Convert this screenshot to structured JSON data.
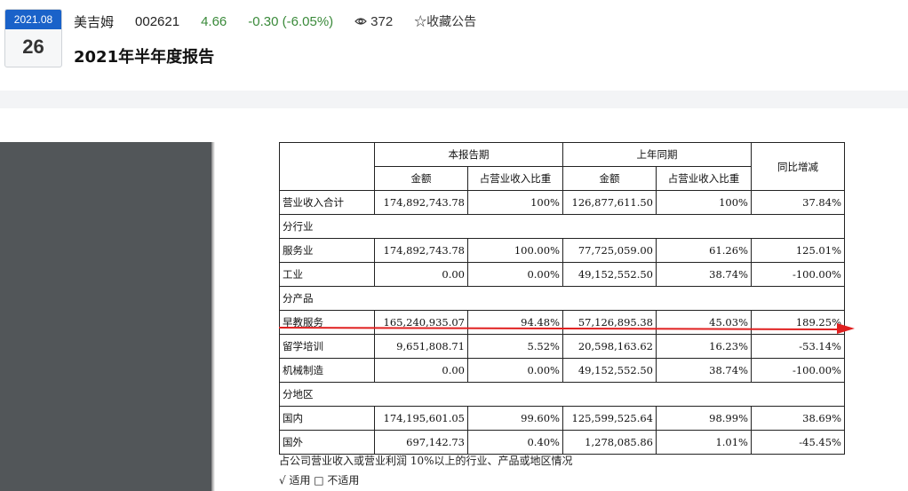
{
  "header": {
    "date_ym": "2021.08",
    "date_day": "26",
    "stock_name": "美吉姆",
    "stock_code": "002621",
    "price": "4.66",
    "change": "-0.30 (-6.05%)",
    "views": "372",
    "favorite_label": "☆收藏公告",
    "title": "2021年半年度报告"
  },
  "table": {
    "col_period_current": "本报告期",
    "col_period_prior": "上年同期",
    "col_yoy": "同比增减",
    "col_amount": "金额",
    "col_ratio": "占营业收入比重",
    "rows": [
      {
        "label": "营业收入合计",
        "a": "174,892,743.78",
        "b": "100%",
        "c": "126,877,611.50",
        "d": "100%",
        "e": "37.84%"
      },
      {
        "section": "分行业"
      },
      {
        "label": "服务业",
        "a": "174,892,743.78",
        "b": "100.00%",
        "c": "77,725,059.00",
        "d": "61.26%",
        "e": "125.01%"
      },
      {
        "label": "工业",
        "a": "0.00",
        "b": "0.00%",
        "c": "49,152,552.50",
        "d": "38.74%",
        "e": "-100.00%"
      },
      {
        "section": "分产品"
      },
      {
        "label": "早教服务",
        "a": "165,240,935.07",
        "b": "94.48%",
        "c": "57,126,895.38",
        "d": "45.03%",
        "e": "189.25%"
      },
      {
        "label": "留学培训",
        "a": "9,651,808.71",
        "b": "5.52%",
        "c": "20,598,163.62",
        "d": "16.23%",
        "e": "-53.14%"
      },
      {
        "label": "机械制造",
        "a": "0.00",
        "b": "0.00%",
        "c": "49,152,552.50",
        "d": "38.74%",
        "e": "-100.00%"
      },
      {
        "section": "分地区"
      },
      {
        "label": "国内",
        "a": "174,195,601.05",
        "b": "99.60%",
        "c": "125,599,525.64",
        "d": "98.99%",
        "e": "38.69%"
      },
      {
        "label": "国外",
        "a": "697,142.73",
        "b": "0.40%",
        "c": "1,278,085.86",
        "d": "1.01%",
        "e": "-45.45%"
      }
    ]
  },
  "notes": {
    "line1": "占公司营业收入或营业利润 10%以上的行业、产品或地区情况",
    "line2": "√ 适用 □ 不适用"
  },
  "colors": {
    "badge_blue": "#1a62c9",
    "down_green": "#3a8a3a",
    "arrow_red": "#e02020"
  }
}
